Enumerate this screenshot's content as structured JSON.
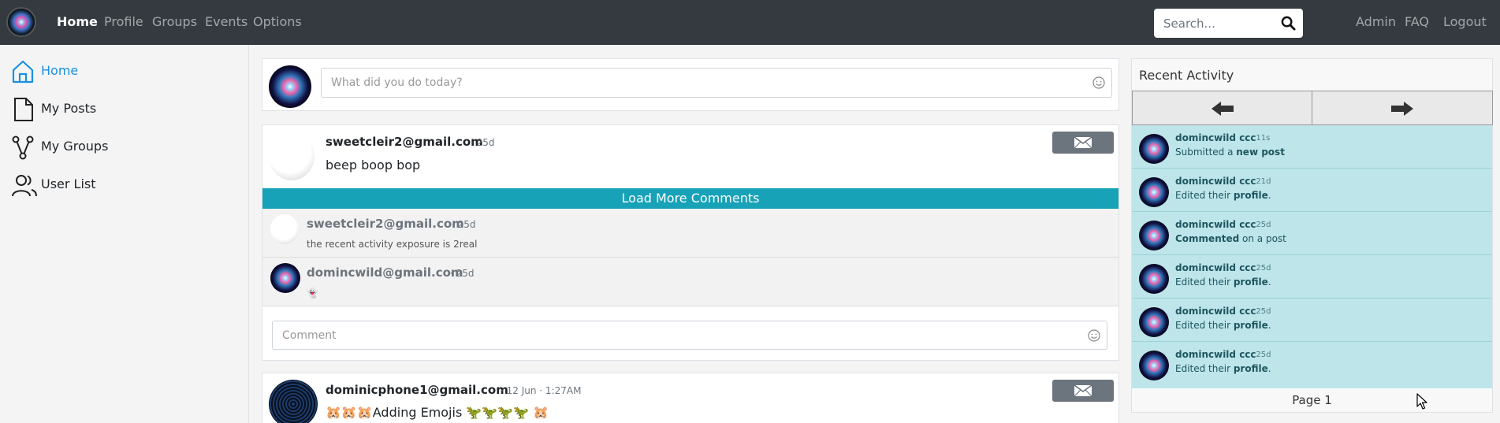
{
  "navbar": {
    "links": [
      {
        "label": "Home",
        "active": true
      },
      {
        "label": "Profile"
      },
      {
        "label": "Groups"
      },
      {
        "label": "Events"
      },
      {
        "label": "Options"
      }
    ],
    "search_placeholder": "Search...",
    "right_links": [
      "Admin",
      "FAQ",
      "Logout"
    ],
    "background": "#343a40"
  },
  "sidebar": {
    "items": [
      {
        "label": "Home",
        "icon": "home-icon",
        "active": true
      },
      {
        "label": "My Posts",
        "icon": "file-icon"
      },
      {
        "label": "My Groups",
        "icon": "groups-icon"
      },
      {
        "label": "User List",
        "icon": "users-icon"
      }
    ],
    "accent": "#1a8fe3"
  },
  "compose": {
    "placeholder": "What did you do today?"
  },
  "posts": [
    {
      "author": "sweetcleir2@gmail.com",
      "meta": "· 25d",
      "text": "beep boop bop",
      "load_more": "Load More Comments",
      "comments": [
        {
          "author": "sweetcleir2@gmail.com",
          "meta": "· 25d",
          "text": "the recent activity exposure is 2real"
        },
        {
          "author": "domincwild@gmail.com",
          "meta": "· 25d",
          "text": "👻"
        }
      ],
      "comment_placeholder": "Comment"
    },
    {
      "author": "dominicphone1@gmail.com",
      "meta": "· 12 Jun · 1:27AM",
      "text": "🐹🐹🐹Adding Emojis 🦖🦖🦖🦖 🐹"
    }
  ],
  "recent_activity": {
    "title": "Recent Activity",
    "items": [
      {
        "user": "domincwild ccc",
        "time": "· 11s",
        "pre": "Submitted a ",
        "bold": "new post",
        "post": ""
      },
      {
        "user": "domincwild ccc",
        "time": "· 21d",
        "pre": "Edited their ",
        "bold": "profile",
        "post": "."
      },
      {
        "user": "domincwild ccc",
        "time": "· 25d",
        "pre": "",
        "bold": "Commented",
        "post": " on a post"
      },
      {
        "user": "domincwild ccc",
        "time": "· 25d",
        "pre": "Edited their ",
        "bold": "profile",
        "post": "."
      },
      {
        "user": "domincwild ccc",
        "time": "· 25d",
        "pre": "Edited their ",
        "bold": "profile",
        "post": "."
      },
      {
        "user": "domincwild ccc",
        "time": "· 25d",
        "pre": "Edited their ",
        "bold": "profile",
        "post": "."
      }
    ],
    "page_label": "Page 1",
    "background": "#bde5ea"
  },
  "colors": {
    "load_more": "#17a2b8",
    "mail_button": "#6c757d"
  }
}
